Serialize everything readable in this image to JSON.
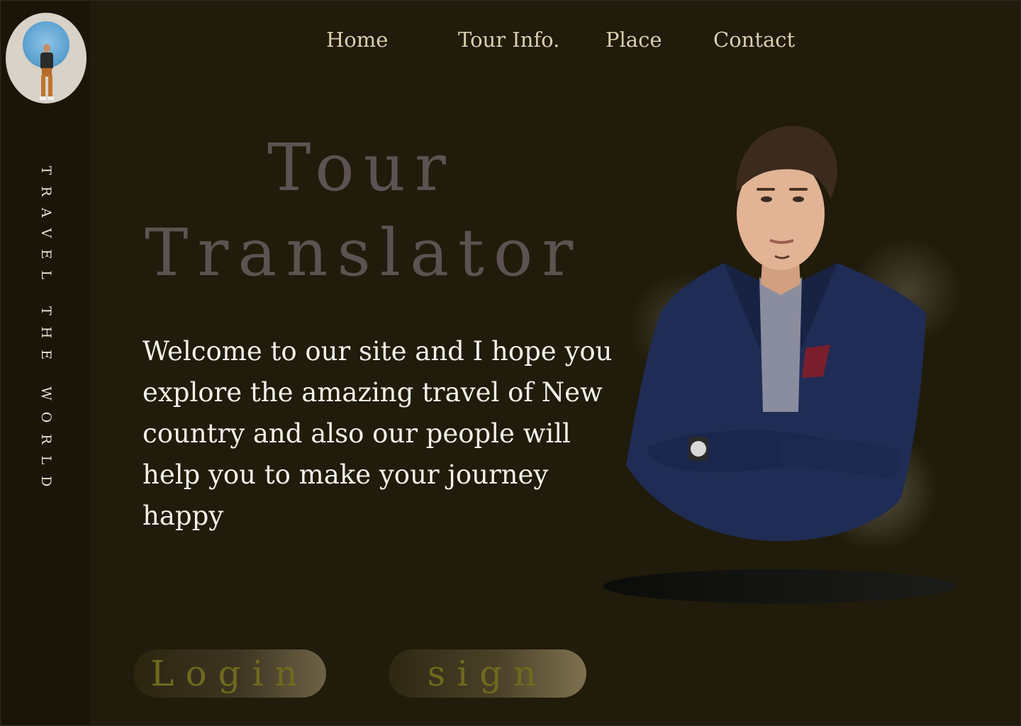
{
  "sidebar": {
    "tagline": "TRAVEL THE WORLD",
    "avatar_icon": "profile-photo"
  },
  "nav": {
    "items": [
      {
        "label": "Home"
      },
      {
        "label": "Tour Info."
      },
      {
        "label": "Place"
      },
      {
        "label": "Contact"
      }
    ]
  },
  "hero": {
    "title_line_1": "Tour",
    "title_line_2": "Translator",
    "welcome_text": "Welcome to our site and I hope you explore the  amazing travel of New country and also our people will help you to make your journey happy"
  },
  "buttons": {
    "login_label": "Login",
    "sign_label": "sign"
  },
  "colors": {
    "background": "#201b0a",
    "sidebar": "#1b1508",
    "nav_text": "#d9cfae",
    "title_text": "#5d5252",
    "body_text": "#f4f1ea",
    "button_text": "#6f6a1c"
  }
}
